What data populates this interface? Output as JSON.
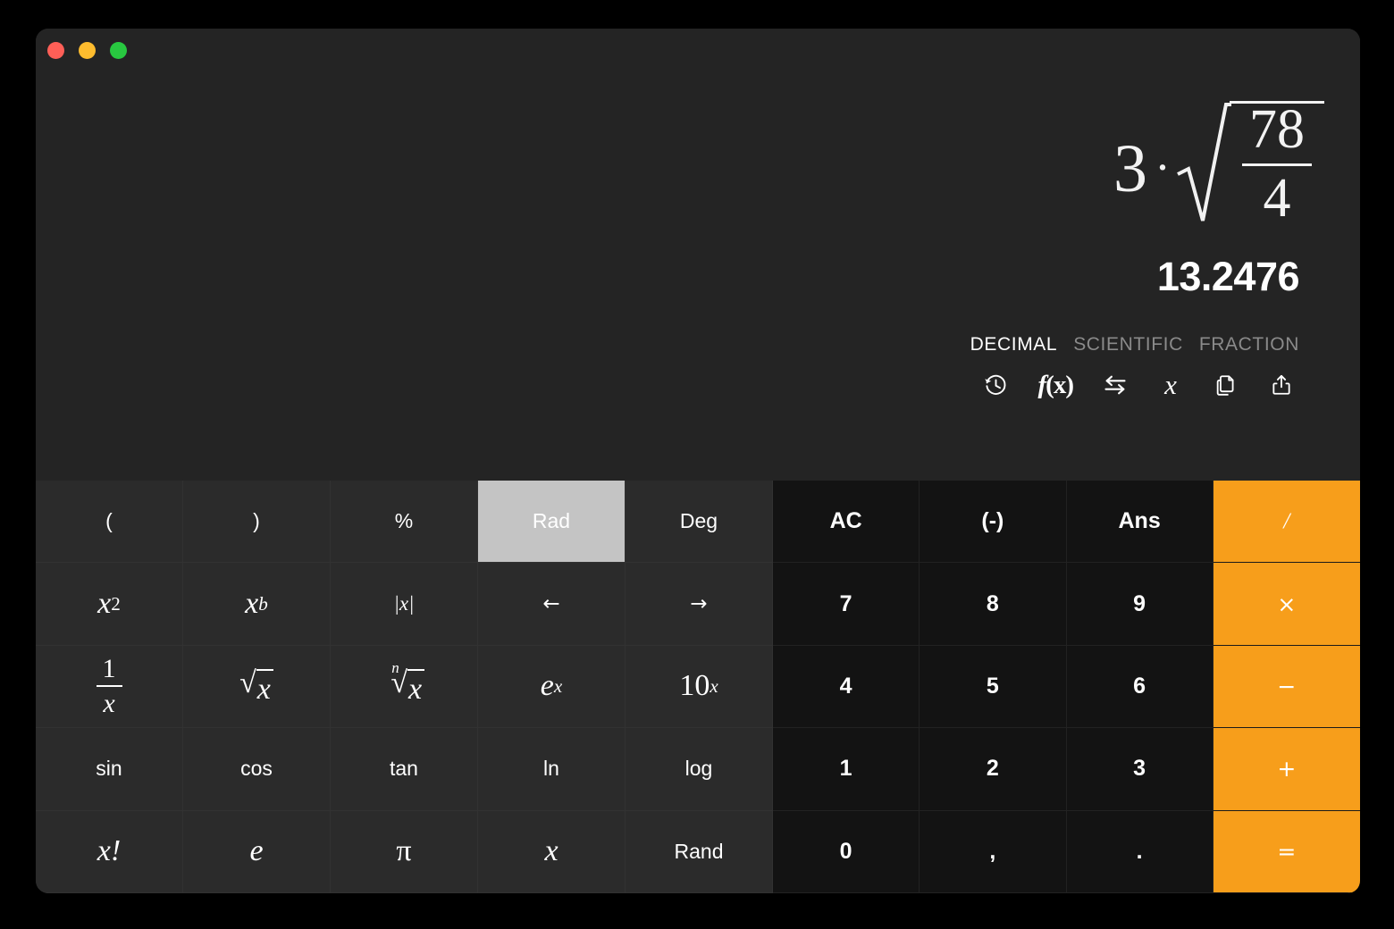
{
  "window": {
    "controls": [
      {
        "name": "close",
        "color": "#FF5F57"
      },
      {
        "name": "minimize",
        "color": "#FEBC2E"
      },
      {
        "name": "zoom",
        "color": "#28C840"
      }
    ]
  },
  "display": {
    "expression": {
      "raw": "3 · √(78/4)",
      "coefficient": "3",
      "operator": "·",
      "radicand_numerator": "78",
      "radicand_denominator": "4"
    },
    "result": "13.2476",
    "modes": [
      {
        "label": "DECIMAL",
        "active": true
      },
      {
        "label": "SCIENTIFIC",
        "active": false
      },
      {
        "label": "FRACTION",
        "active": false
      }
    ],
    "icons": [
      {
        "name": "history-icon",
        "label": "history"
      },
      {
        "name": "function-icon",
        "label": "f(x)"
      },
      {
        "name": "swap-icon",
        "label": "swap"
      },
      {
        "name": "variable-icon",
        "label": "x"
      },
      {
        "name": "copy-icon",
        "label": "copy"
      },
      {
        "name": "share-icon",
        "label": "share"
      }
    ]
  },
  "keypad": {
    "function_keys": [
      {
        "name": "open-paren",
        "label": "(",
        "style": "plain"
      },
      {
        "name": "close-paren",
        "label": ")",
        "style": "plain"
      },
      {
        "name": "percent",
        "label": "%",
        "style": "plain"
      },
      {
        "name": "rad",
        "label": "Rad",
        "style": "plain",
        "highlight": true
      },
      {
        "name": "deg",
        "label": "Deg",
        "style": "plain"
      },
      {
        "name": "x-squared",
        "label": "x²",
        "style": "math"
      },
      {
        "name": "x-power-b",
        "label": "xᵇ",
        "style": "math"
      },
      {
        "name": "absolute-value",
        "label": "|x|",
        "style": "math"
      },
      {
        "name": "cursor-left",
        "label": "←",
        "style": "arrow"
      },
      {
        "name": "cursor-right",
        "label": "→",
        "style": "arrow"
      },
      {
        "name": "reciprocal",
        "label": "1/x",
        "style": "frac"
      },
      {
        "name": "square-root",
        "label": "√x",
        "style": "sqrt"
      },
      {
        "name": "nth-root",
        "label": "ⁿ√x",
        "style": "nthroot"
      },
      {
        "name": "e-power-x",
        "label": "eˣ",
        "style": "math"
      },
      {
        "name": "ten-power-x",
        "label": "10ˣ",
        "style": "math"
      },
      {
        "name": "sin",
        "label": "sin",
        "style": "plain"
      },
      {
        "name": "cos",
        "label": "cos",
        "style": "plain"
      },
      {
        "name": "tan",
        "label": "tan",
        "style": "plain"
      },
      {
        "name": "ln",
        "label": "ln",
        "style": "plain"
      },
      {
        "name": "log",
        "label": "log",
        "style": "plain"
      },
      {
        "name": "factorial",
        "label": "x!",
        "style": "math"
      },
      {
        "name": "euler-e",
        "label": "e",
        "style": "math"
      },
      {
        "name": "pi",
        "label": "π",
        "style": "math"
      },
      {
        "name": "variable-x",
        "label": "x",
        "style": "math"
      },
      {
        "name": "rand",
        "label": "Rand",
        "style": "plain"
      }
    ],
    "number_keys": [
      {
        "name": "all-clear",
        "label": "AC",
        "type": "num"
      },
      {
        "name": "negate",
        "label": "(-)",
        "type": "num"
      },
      {
        "name": "answer",
        "label": "Ans",
        "type": "num"
      },
      {
        "name": "divide",
        "label": "/",
        "type": "op"
      },
      {
        "name": "seven",
        "label": "7",
        "type": "num"
      },
      {
        "name": "eight",
        "label": "8",
        "type": "num"
      },
      {
        "name": "nine",
        "label": "9",
        "type": "num"
      },
      {
        "name": "multiply",
        "label": "×",
        "type": "op"
      },
      {
        "name": "four",
        "label": "4",
        "type": "num"
      },
      {
        "name": "five",
        "label": "5",
        "type": "num"
      },
      {
        "name": "six",
        "label": "6",
        "type": "num"
      },
      {
        "name": "subtract",
        "label": "−",
        "type": "op"
      },
      {
        "name": "one",
        "label": "1",
        "type": "num"
      },
      {
        "name": "two",
        "label": "2",
        "type": "num"
      },
      {
        "name": "three",
        "label": "3",
        "type": "num"
      },
      {
        "name": "add",
        "label": "+",
        "type": "op"
      },
      {
        "name": "zero",
        "label": "0",
        "type": "num"
      },
      {
        "name": "comma",
        "label": ",",
        "type": "num"
      },
      {
        "name": "decimal-point",
        "label": ".",
        "type": "num"
      },
      {
        "name": "equals",
        "label": "=",
        "type": "op"
      }
    ]
  },
  "colors": {
    "accent_orange": "#F79E1B",
    "window_bg": "#242424",
    "fn_panel_bg": "#2B2B2B",
    "num_panel_bg": "#131313",
    "highlight": "#C4C4C4"
  }
}
